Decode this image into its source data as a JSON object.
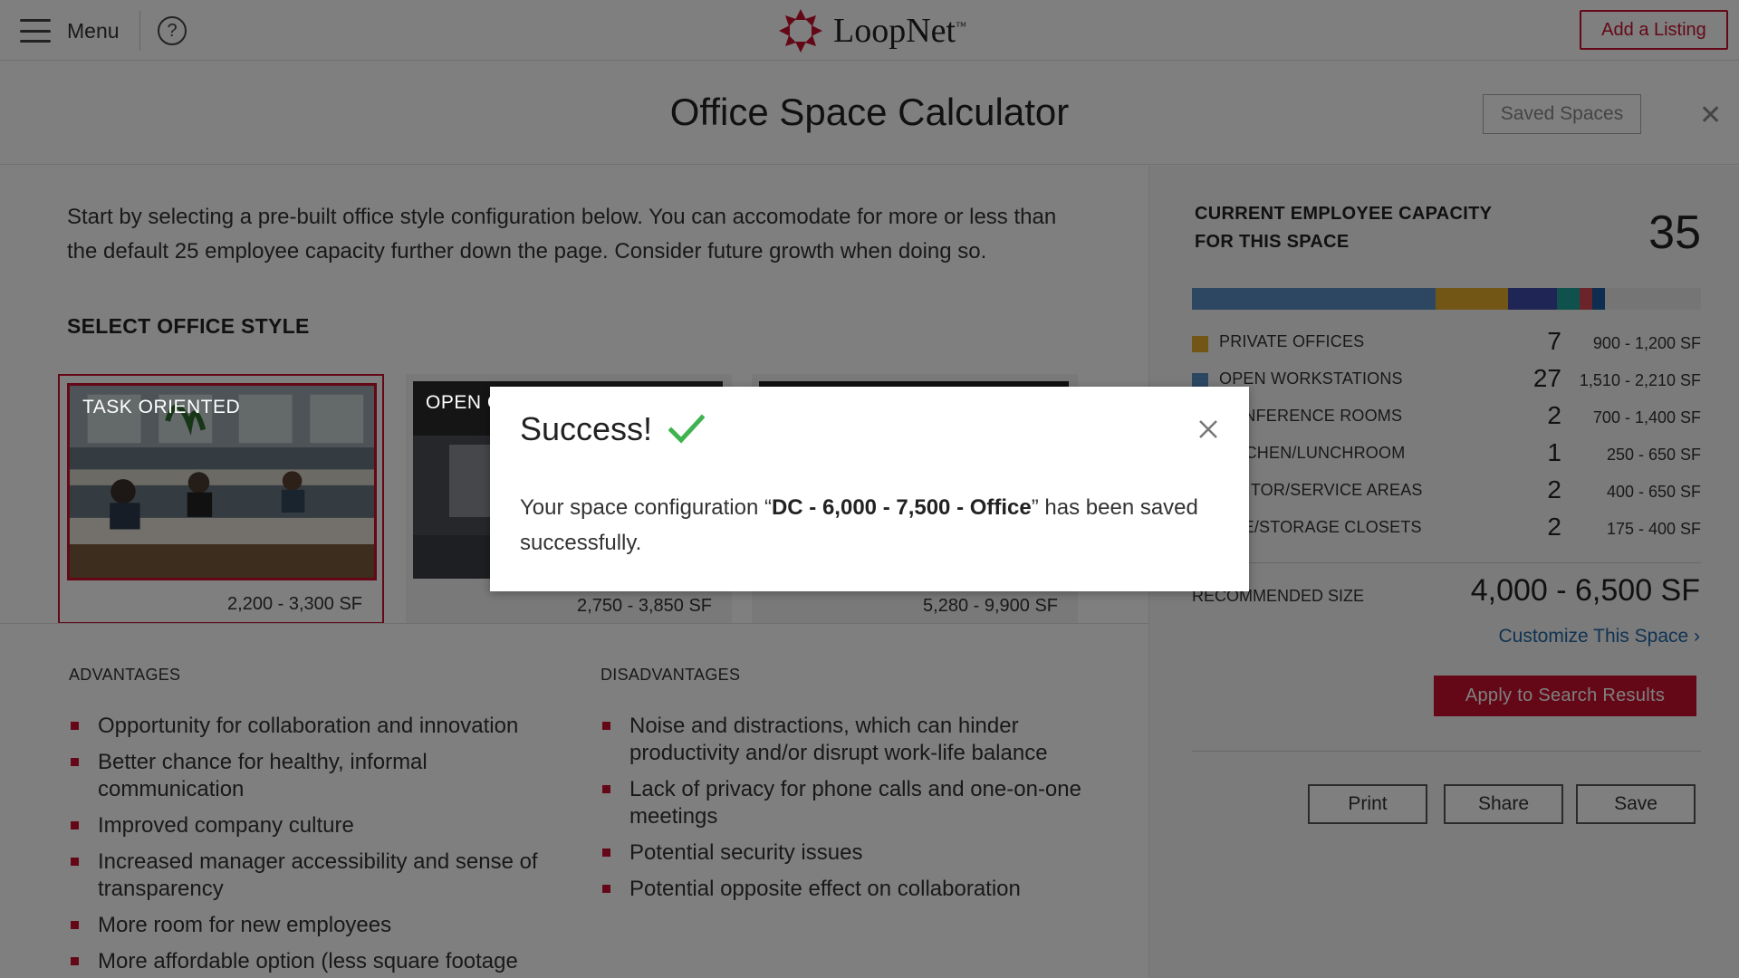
{
  "nav": {
    "menu_label": "Menu",
    "help_glyph": "?",
    "logo_text": "LoopNet",
    "logo_tm": "™",
    "add_listing": "Add a Listing"
  },
  "header": {
    "title": "Office Space Calculator",
    "saved_spaces": "Saved Spaces",
    "close_glyph": "✕"
  },
  "intro": "Start by selecting a pre-built office style configuration below. You can accomodate for more or less than the default 25 employee capacity further down the page. Consider future growth when doing so.",
  "select_title": "SELECT OFFICE STYLE",
  "cards": [
    {
      "label": "TASK ORIENTED",
      "size": "2,200 - 3,300 SF"
    },
    {
      "label": "OPEN C",
      "size": "2,750 - 3,850 SF"
    },
    {
      "label": "",
      "size": "5,280 - 9,900 SF"
    }
  ],
  "advantages": {
    "title": "ADVANTAGES",
    "items": [
      "Opportunity for collaboration and innovation",
      "Better chance for healthy, informal communication",
      "Improved company culture",
      "Increased manager accessibility and sense of transparency",
      "More room for new employees",
      "More affordable option (less square footage"
    ]
  },
  "disadvantages": {
    "title": "DISADVANTAGES",
    "items": [
      "Noise and distractions, which can hinder productivity and/or disrupt work-life balance",
      "Lack of privacy for phone calls and one-on-one meetings",
      "Potential security issues",
      "Potential opposite effect on collaboration"
    ]
  },
  "capacity": {
    "label": "CURRENT EMPLOYEE CAPACITY FOR THIS SPACE",
    "value": "35",
    "bar": [
      {
        "color": "#5b8fc7",
        "fraction": 0.478
      },
      {
        "color": "#e2ad2b",
        "fraction": 0.143
      },
      {
        "color": "#3e4aa8",
        "fraction": 0.097
      },
      {
        "color": "#1fa39a",
        "fraction": 0.044
      },
      {
        "color": "#d64a55",
        "fraction": 0.025
      },
      {
        "color": "#1c5aa3",
        "fraction": 0.025
      }
    ]
  },
  "rows": [
    {
      "label": "PRIVATE OFFICES",
      "count": "7",
      "range": "900 - 1,200 SF",
      "color": "#e2ad2b"
    },
    {
      "label": "OPEN WORKSTATIONS",
      "count": "27",
      "range": "1,510 - 2,210 SF",
      "color": "#5b8fc7"
    },
    {
      "label": "CONFERENCE ROOMS",
      "count": "2",
      "range": "700 - 1,400 SF",
      "color": "#3e4aa8"
    },
    {
      "label": "KITCHEN/LUNCHROOM",
      "count": "1",
      "range": "250 - 650 SF",
      "color": "#1fa39a"
    },
    {
      "label": "VISITOR/SERVICE AREAS",
      "count": "2",
      "range": "400 - 650 SF",
      "color": "#d64a55"
    },
    {
      "label": "FILE/STORAGE CLOSETS",
      "count": "2",
      "range": "175 - 400 SF",
      "color": "#1c5aa3"
    }
  ],
  "recommended": {
    "label": "RECOMMENDED SIZE",
    "value": "4,000 - 6,500 SF"
  },
  "customize": "Customize This Space ›",
  "apply": "Apply to Search Results",
  "actions": {
    "print": "Print",
    "share": "Share",
    "save": "Save"
  },
  "modal": {
    "title": "Success!",
    "text_before": "Your space configuration “",
    "config_name": "DC - 6,000 - 7,500 - Office",
    "text_after": "” has been saved successfully.",
    "check_color": "#3fb34f"
  }
}
